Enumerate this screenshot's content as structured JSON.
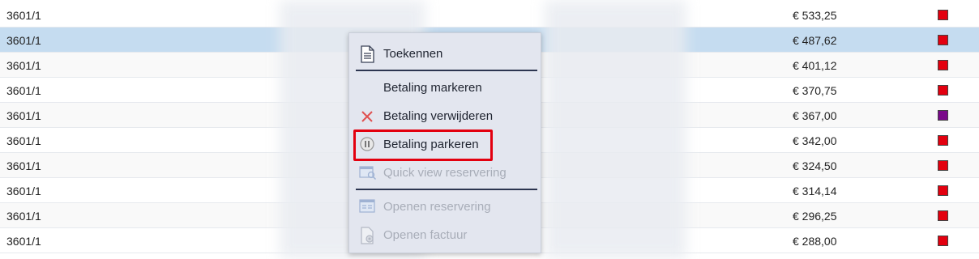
{
  "rows": [
    {
      "code": "3601/1",
      "amount": "€ 533,25",
      "status_color": "#e3000f"
    },
    {
      "code": "3601/1",
      "amount": "€ 487,62",
      "status_color": "#e3000f"
    },
    {
      "code": "3601/1",
      "amount": "€ 401,12",
      "status_color": "#e3000f"
    },
    {
      "code": "3601/1",
      "amount": "€ 370,75",
      "status_color": "#e3000f"
    },
    {
      "code": "3601/1",
      "amount": "€ 367,00",
      "status_color": "#7a0a8a"
    },
    {
      "code": "3601/1",
      "amount": "€ 342,00",
      "status_color": "#e3000f"
    },
    {
      "code": "3601/1",
      "amount": "€ 324,50",
      "status_color": "#e3000f"
    },
    {
      "code": "3601/1",
      "amount": "€ 314,14",
      "status_color": "#e3000f"
    },
    {
      "code": "3601/1",
      "amount": "€ 296,25",
      "status_color": "#e3000f"
    },
    {
      "code": "3601/1",
      "amount": "€ 288,00",
      "status_color": "#e3000f"
    }
  ],
  "context_menu": {
    "items": [
      {
        "label": "Toekennen",
        "icon": "document-icon",
        "disabled": false
      },
      {
        "label": "Betaling markeren",
        "icon": "",
        "disabled": false
      },
      {
        "label": "Betaling verwijderen",
        "icon": "close-icon",
        "disabled": false
      },
      {
        "label": "Betaling parkeren",
        "icon": "pause-icon",
        "disabled": false
      },
      {
        "label": "Quick view reservering",
        "icon": "quick-view-icon",
        "disabled": true
      },
      {
        "label": "Openen reservering",
        "icon": "window-icon",
        "disabled": true
      },
      {
        "label": "Openen factuur",
        "icon": "invoice-icon",
        "disabled": true
      }
    ],
    "highlighted_item": "Betaling parkeren",
    "highlight_color": "#e3000f"
  }
}
